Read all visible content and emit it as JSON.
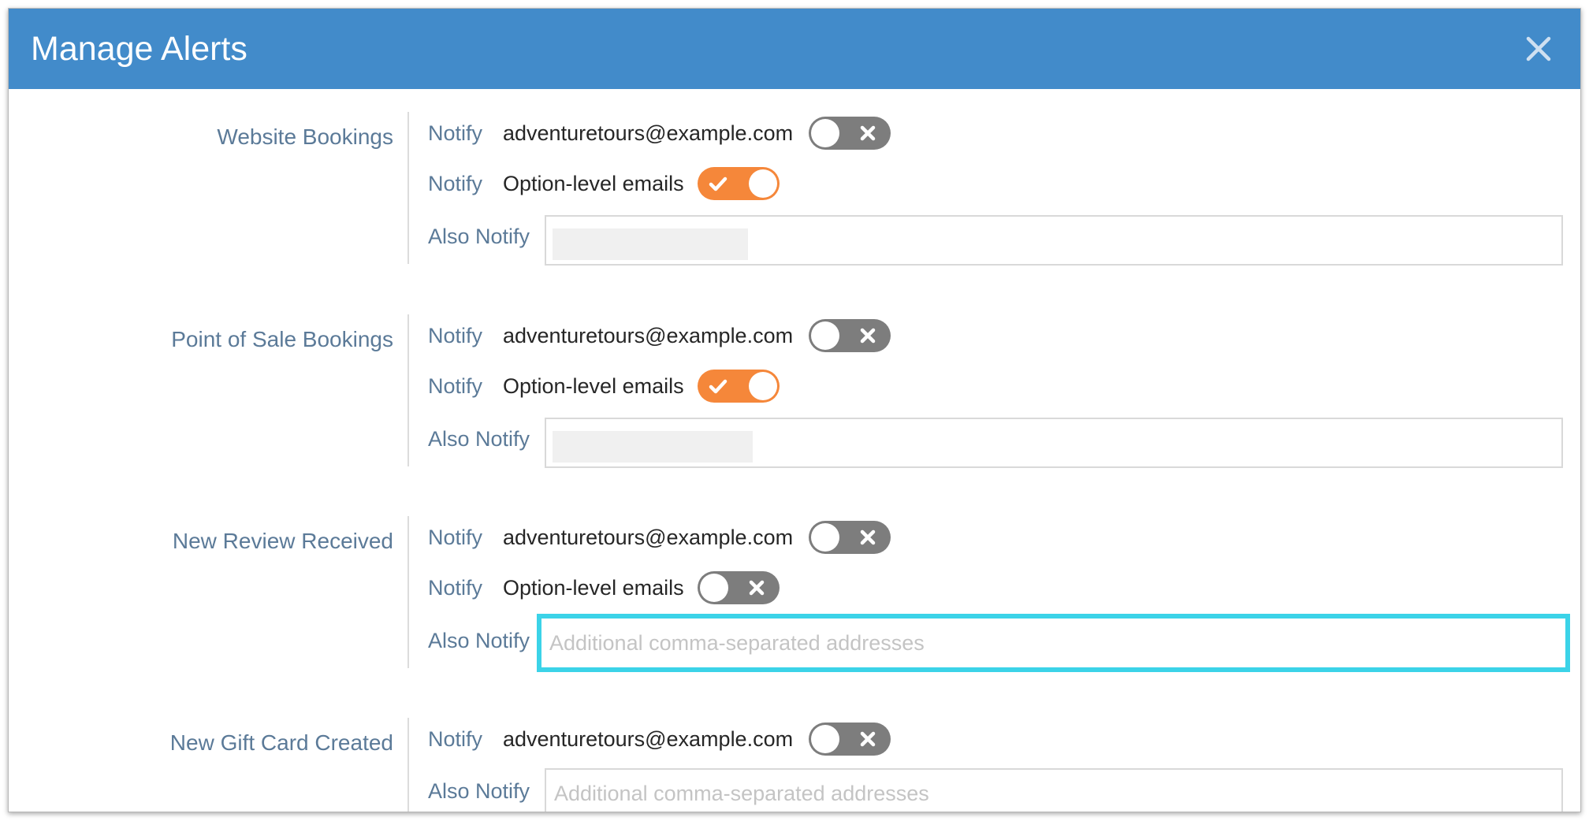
{
  "modal": {
    "title": "Manage Alerts",
    "close_icon": "close-icon",
    "header_color": "#428bca"
  },
  "colors": {
    "toggle_on": "#f5873a",
    "toggle_off": "#7d7d7d",
    "label": "#5b7a98",
    "focus_ring": "#3bd3e8"
  },
  "sections": [
    {
      "label": "Website Bookings",
      "notify_label": "Notify",
      "email": "adventuretours@example.com",
      "email_toggle": "off",
      "option_label": "Notify",
      "option_text": "Option-level emails",
      "option_toggle": "on",
      "also_label": "Also Notify",
      "also_value": "",
      "also_placeholder": ""
    },
    {
      "label": "Point of Sale Bookings",
      "notify_label": "Notify",
      "email": "adventuretours@example.com",
      "email_toggle": "off",
      "option_label": "Notify",
      "option_text": "Option-level emails",
      "option_toggle": "on",
      "also_label": "Also Notify",
      "also_value": "",
      "also_placeholder": ""
    },
    {
      "label": "New Review Received",
      "notify_label": "Notify",
      "email": "adventuretours@example.com",
      "email_toggle": "off",
      "option_label": "Notify",
      "option_text": "Option-level emails",
      "option_toggle": "off",
      "also_label": "Also Notify",
      "also_value": "",
      "also_placeholder": "Additional comma-separated addresses"
    },
    {
      "label": "New Gift Card Created",
      "notify_label": "Notify",
      "email": "adventuretours@example.com",
      "email_toggle": "off",
      "also_label": "Also Notify",
      "also_value": "",
      "also_placeholder": "Additional comma-separated addresses"
    }
  ]
}
